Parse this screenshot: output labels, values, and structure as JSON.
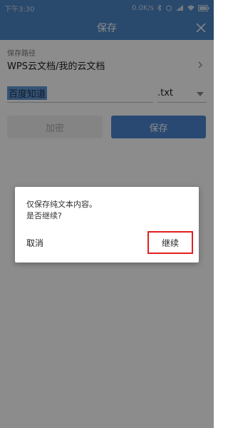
{
  "status_bar": {
    "time": "下午3:30",
    "network": "0.0K/s"
  },
  "header": {
    "title": "保存"
  },
  "form": {
    "path_label": "保存路径",
    "path_value": "WPS云文档/我的云文档",
    "file_name": "百度知道",
    "extension": ".txt",
    "encrypt_label": "加密",
    "save_label": "保存"
  },
  "dialog": {
    "message_line1": "仅保存纯文本内容。",
    "message_line2": "是否继续?",
    "cancel_label": "取消",
    "continue_label": "继续"
  },
  "colors": {
    "header_bg": "#4c86c7",
    "primary_button": "#4c86d0",
    "highlight_box": "#e02020"
  }
}
